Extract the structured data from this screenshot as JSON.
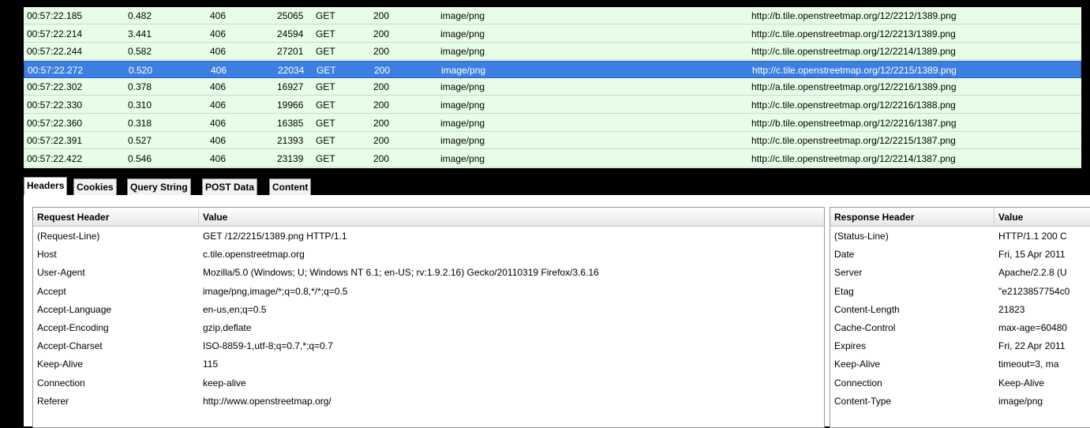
{
  "requests": [
    {
      "time": "00:57:22.185",
      "duration": "0.482",
      "sent": "406",
      "received": "25065",
      "method": "GET",
      "result": "200",
      "type": "image/png",
      "url": "http://b.tile.openstreetmap.org/12/2212/1389.png"
    },
    {
      "time": "00:57:22.214",
      "duration": "3.441",
      "sent": "406",
      "received": "24594",
      "method": "GET",
      "result": "200",
      "type": "image/png",
      "url": "http://c.tile.openstreetmap.org/12/2213/1389.png"
    },
    {
      "time": "00:57:22.244",
      "duration": "0.582",
      "sent": "406",
      "received": "27201",
      "method": "GET",
      "result": "200",
      "type": "image/png",
      "url": "http://c.tile.openstreetmap.org/12/2214/1389.png"
    },
    {
      "time": "00:57:22.272",
      "duration": "0.520",
      "sent": "406",
      "received": "22034",
      "method": "GET",
      "result": "200",
      "type": "image/png",
      "url": "http://c.tile.openstreetmap.org/12/2215/1389.png"
    },
    {
      "time": "00:57:22.302",
      "duration": "0.378",
      "sent": "406",
      "received": "16927",
      "method": "GET",
      "result": "200",
      "type": "image/png",
      "url": "http://a.tile.openstreetmap.org/12/2216/1389.png"
    },
    {
      "time": "00:57:22.330",
      "duration": "0.310",
      "sent": "406",
      "received": "19966",
      "method": "GET",
      "result": "200",
      "type": "image/png",
      "url": "http://c.tile.openstreetmap.org/12/2216/1388.png"
    },
    {
      "time": "00:57:22.360",
      "duration": "0.318",
      "sent": "406",
      "received": "16385",
      "method": "GET",
      "result": "200",
      "type": "image/png",
      "url": "http://b.tile.openstreetmap.org/12/2216/1387.png"
    },
    {
      "time": "00:57:22.391",
      "duration": "0.527",
      "sent": "406",
      "received": "21393",
      "method": "GET",
      "result": "200",
      "type": "image/png",
      "url": "http://c.tile.openstreetmap.org/12/2215/1387.png"
    },
    {
      "time": "00:57:22.422",
      "duration": "0.546",
      "sent": "406",
      "received": "23139",
      "method": "GET",
      "result": "200",
      "type": "image/png",
      "url": "http://c.tile.openstreetmap.org/12/2214/1387.png"
    }
  ],
  "selected_request_index": 3,
  "tabs": [
    "Headers",
    "Cookies",
    "Query String",
    "POST Data",
    "Content"
  ],
  "active_tab": "Headers",
  "request_headers": {
    "col_name": "Request Header",
    "col_value": "Value",
    "rows": [
      {
        "name": "(Request-Line)",
        "value": "GET /12/2215/1389.png HTTP/1.1"
      },
      {
        "name": "Host",
        "value": "c.tile.openstreetmap.org"
      },
      {
        "name": "User-Agent",
        "value": "Mozilla/5.0 (Windows; U; Windows NT 6.1; en-US; rv:1.9.2.16) Gecko/20110319 Firefox/3.6.16"
      },
      {
        "name": "Accept",
        "value": "image/png,image/*;q=0.8,*/*;q=0.5"
      },
      {
        "name": "Accept-Language",
        "value": "en-us,en;q=0.5"
      },
      {
        "name": "Accept-Encoding",
        "value": "gzip,deflate"
      },
      {
        "name": "Accept-Charset",
        "value": "ISO-8859-1,utf-8;q=0.7,*;q=0.7"
      },
      {
        "name": "Keep-Alive",
        "value": "115"
      },
      {
        "name": "Connection",
        "value": "keep-alive"
      },
      {
        "name": "Referer",
        "value": "http://www.openstreetmap.org/"
      }
    ]
  },
  "response_headers": {
    "col_name": "Response Header",
    "col_value": "Value",
    "rows": [
      {
        "name": "(Status-Line)",
        "value": "HTTP/1.1 200 C"
      },
      {
        "name": "Date",
        "value": "Fri, 15 Apr 2011"
      },
      {
        "name": "Server",
        "value": "Apache/2.2.8 (U"
      },
      {
        "name": "Etag",
        "value": "\"e2123857754c0"
      },
      {
        "name": "Content-Length",
        "value": "21823"
      },
      {
        "name": "Cache-Control",
        "value": "max-age=60480"
      },
      {
        "name": "Expires",
        "value": "Fri, 22 Apr 2011"
      },
      {
        "name": "Keep-Alive",
        "value": "timeout=3, ma"
      },
      {
        "name": "Connection",
        "value": "Keep-Alive"
      },
      {
        "name": "Content-Type",
        "value": "image/png"
      }
    ]
  }
}
